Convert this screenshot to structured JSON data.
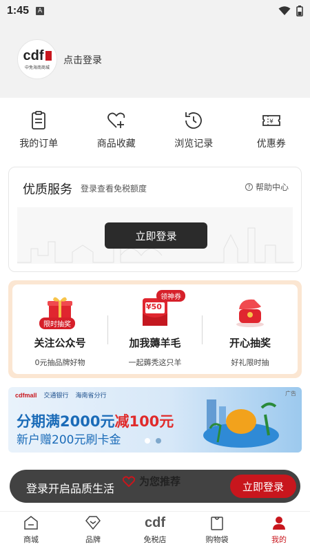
{
  "status": {
    "time": "1:45"
  },
  "header": {
    "logo_text": "cdf",
    "logo_sub": "中免海南商城",
    "login_link": "点击登录"
  },
  "quick_links": [
    {
      "label": "我的订单",
      "icon": "order-icon"
    },
    {
      "label": "商品收藏",
      "icon": "heart-plus-icon"
    },
    {
      "label": "浏览记录",
      "icon": "history-icon"
    },
    {
      "label": "优惠券",
      "icon": "coupon-icon"
    }
  ],
  "service": {
    "title": "优质服务",
    "subtitle": "登录查看免税额度",
    "help": "帮助中心",
    "login_button": "立即登录"
  },
  "promo": {
    "items": [
      {
        "name": "关注公众号",
        "desc": "0元抽品牌好物",
        "badge": "限时抽奖"
      },
      {
        "name": "加我薅羊毛",
        "desc": "一起薅秃这只羊",
        "badge": "领神券",
        "coupon_value": "¥50"
      },
      {
        "name": "开心抽奖",
        "desc": "好礼限时抽"
      }
    ]
  },
  "banner": {
    "logo": "cdfmall",
    "bank": "交通银行",
    "branch": "海南省分行",
    "ad_label": "广告",
    "line1_a": "分期满2000元",
    "line1_b": "减100元",
    "line2": "新户赠200元刷卡金"
  },
  "recommend_title": "为您推荐",
  "toast": {
    "text": "登录开启品质生活",
    "button": "立即登录"
  },
  "tabbar": [
    {
      "label": "商城",
      "icon": "home-icon"
    },
    {
      "label": "品牌",
      "icon": "brand-icon"
    },
    {
      "label": "免税店",
      "icon": "cdf-logo-icon"
    },
    {
      "label": "购物袋",
      "icon": "bag-icon"
    },
    {
      "label": "我的",
      "icon": "user-icon",
      "active": true
    }
  ],
  "colors": {
    "brand_red": "#c8161d",
    "dark_button": "#2b2b2b",
    "banner_blue": "#1a6bb8"
  }
}
